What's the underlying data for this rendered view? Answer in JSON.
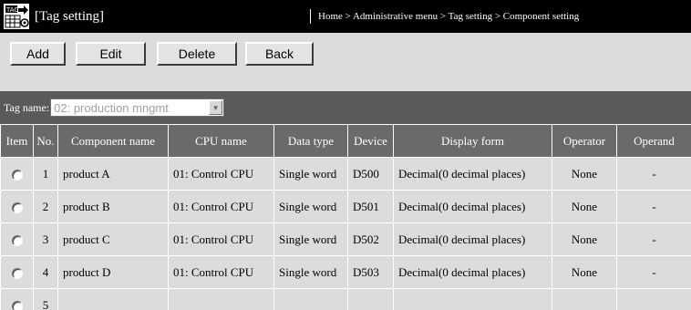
{
  "header": {
    "title": "[Tag setting]",
    "breadcrumb": "Home > Administrative menu > Tag setting > Component setting",
    "icon": "tag-setting-icon"
  },
  "toolbar": {
    "add_label": "Add",
    "edit_label": "Edit",
    "delete_label": "Delete",
    "back_label": "Back"
  },
  "tag": {
    "label": "Tag name:",
    "selected": "02: production mngmt"
  },
  "table": {
    "headers": [
      "Item",
      "No.",
      "Component name",
      "CPU name",
      "Data type",
      "Device",
      "Display form",
      "Operator",
      "Operand"
    ],
    "rows": [
      {
        "no": "1",
        "component": "product A",
        "cpu": "01: Control CPU",
        "type": "Single word",
        "device": "D500",
        "display": "Decimal(0 decimal places)",
        "operator": "None",
        "operand": "-"
      },
      {
        "no": "2",
        "component": "product B",
        "cpu": "01: Control CPU",
        "type": "Single word",
        "device": "D501",
        "display": "Decimal(0 decimal places)",
        "operator": "None",
        "operand": "-"
      },
      {
        "no": "3",
        "component": "product C",
        "cpu": "01: Control CPU",
        "type": "Single word",
        "device": "D502",
        "display": "Decimal(0 decimal places)",
        "operator": "None",
        "operand": "-"
      },
      {
        "no": "4",
        "component": "product D",
        "cpu": "01: Control CPU",
        "type": "Single word",
        "device": "D503",
        "display": "Decimal(0 decimal places)",
        "operator": "None",
        "operand": "-"
      },
      {
        "no": "5",
        "component": "",
        "cpu": "",
        "type": "",
        "device": "",
        "display": "",
        "operator": "",
        "operand": ""
      }
    ]
  }
}
